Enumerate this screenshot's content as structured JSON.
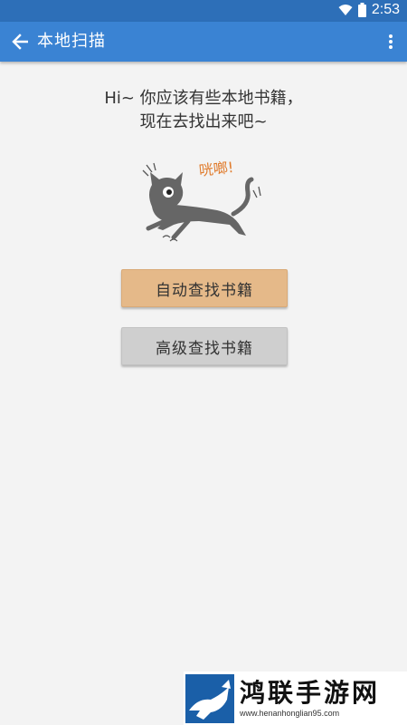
{
  "status_bar": {
    "time": "2:53",
    "icons": [
      "wifi-icon",
      "battery-icon"
    ]
  },
  "app_bar": {
    "title": "本地扫描",
    "back_icon": "arrow-left-icon",
    "menu_icon": "more-vert-icon"
  },
  "greeting": {
    "line1": "Hi~ 你应该有些本地书籍，",
    "line2": "现在去找出来吧~"
  },
  "illustration": {
    "caption": "咣啷!",
    "icon": "cat-illustration"
  },
  "buttons": {
    "auto_search": "自动查找书籍",
    "advanced_search": "高级查找书籍"
  },
  "watermark": {
    "brand": "鸿联手游网",
    "domain": "www.henanhonglian95.com"
  },
  "colors": {
    "status_bar": "#2d6fb8",
    "app_bar": "#3a83d3",
    "background": "#f3f3f3",
    "auto_button": "#e5b989",
    "advanced_button": "#cfcfcf",
    "caption": "#e07a2a"
  }
}
